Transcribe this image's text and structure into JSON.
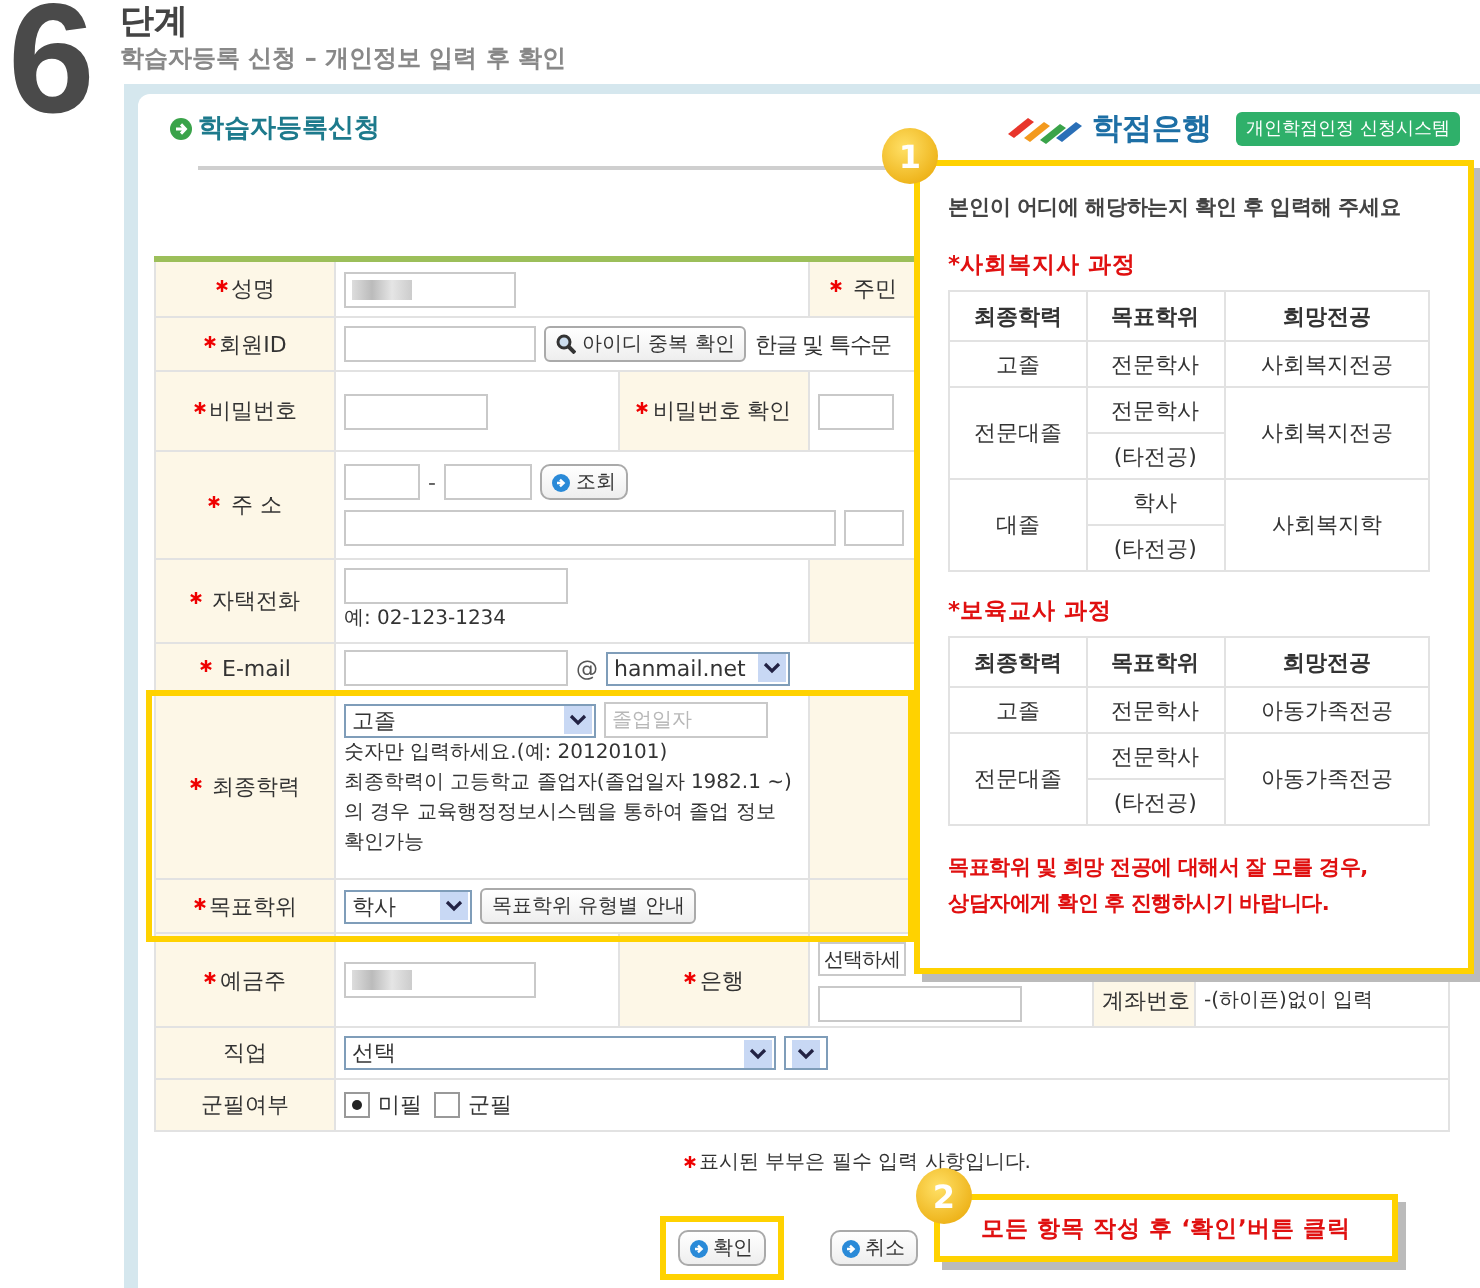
{
  "step": {
    "number": "6",
    "title": "단계",
    "subtitle": "학습자등록 신청 – 개인정보 입력 후 확인"
  },
  "panel": {
    "title": "학습자등록신청",
    "logo_text": "학점은행",
    "badge": "개인학점인정 신청시스템"
  },
  "form": {
    "name": {
      "label": {
        "text": "성명",
        "required": true
      },
      "id_label": {
        "text": "주민",
        "required": true
      }
    },
    "member_id": {
      "label": {
        "text": "회원ID",
        "required": true
      },
      "check_button": "아이디 중복 확인",
      "hint": "한글 및 특수문"
    },
    "password": {
      "label": {
        "text": "비밀번호",
        "required": true
      },
      "confirm_label": {
        "text": "비밀번호 확인",
        "required": true
      }
    },
    "address": {
      "label": {
        "text": "주 소",
        "required": true
      },
      "separator": "-",
      "search_button": "조회"
    },
    "home_phone": {
      "label": {
        "text": "자택전화",
        "required": true
      },
      "example": "예: 02-123-1234"
    },
    "email": {
      "label": {
        "text": "E-mail",
        "required": true
      },
      "at": "@",
      "domain": "hanmail.net"
    },
    "education": {
      "label": {
        "text": "최종학력",
        "required": true
      },
      "value": "고졸",
      "date_placeholder": "졸업일자",
      "hint": "숫자만 입력하세요.(예: 20120101)",
      "note": "최종학력이 고등학교 졸업자(졸업일자 1982.1 ~)의 경우 교육행정정보시스템을 통하여 졸업 정보 확인가능"
    },
    "target_degree": {
      "label": {
        "text": "목표학위",
        "required": true
      },
      "value": "학사",
      "guide_button": "목표학위 유형별 안내"
    },
    "account_holder": {
      "label": {
        "text": "예금주",
        "required": true
      },
      "bank_label": {
        "text": "은행",
        "required": true
      },
      "bank_value": "선택하세",
      "account_label": {
        "text": "계좌번호",
        "required": false
      },
      "account_hint": "-(하이픈)없이 입력"
    },
    "job": {
      "label": {
        "text": "직업",
        "required": false
      },
      "value": "선택"
    },
    "military": {
      "label": {
        "text": "군필여부",
        "required": false
      },
      "options": [
        {
          "label": "미필",
          "selected": true
        },
        {
          "label": "군필",
          "selected": false
        }
      ]
    }
  },
  "required_note": "표시된 부부은 필수 입력 사항입니다.",
  "buttons": [
    {
      "label": "확인",
      "highlighted": true
    },
    {
      "label": "취소",
      "highlighted": false
    }
  ],
  "guide": {
    "number": "1",
    "intro": "본인이 어디에 해당하는지 확인 후 입력해 주세요",
    "sections": [
      {
        "title": "*사회복지사 과정",
        "columns": [
          "최종학력",
          "목표학위",
          "희망전공"
        ],
        "rows": [
          {
            "education": "고졸",
            "degrees": [
              "전문학사"
            ],
            "major": "사회복지전공"
          },
          {
            "education": "전문대졸",
            "degrees": [
              "전문학사",
              "(타전공)"
            ],
            "major": "사회복지전공"
          },
          {
            "education": "대졸",
            "degrees": [
              "학사",
              "(타전공)"
            ],
            "major": "사회복지학"
          }
        ]
      },
      {
        "title": "*보육교사 과정",
        "columns": [
          "최종학력",
          "목표학위",
          "희망전공"
        ],
        "rows": [
          {
            "education": "고졸",
            "degrees": [
              "전문학사"
            ],
            "major": "아동가족전공"
          },
          {
            "education": "전문대졸",
            "degrees": [
              "전문학사",
              "(타전공)"
            ],
            "major": "아동가족전공"
          }
        ]
      }
    ],
    "note_lines": [
      "목표학위 및 희망 전공에 대해서 잘 모를 경우,",
      "상담자에게 확인 후 진행하시기 바랍니다."
    ]
  },
  "tip": {
    "number": "2",
    "text": "모든 항목 작성 후 ‘확인’버튼 클릭"
  }
}
